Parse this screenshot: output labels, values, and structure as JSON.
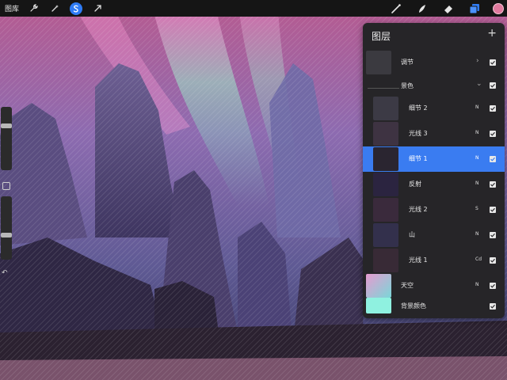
{
  "toolbar": {
    "gallery_label": "图库",
    "tools_left": [
      "wrench-icon",
      "magic-wand-icon",
      "selection-icon",
      "transform-icon"
    ],
    "tools_right": [
      "brush-icon",
      "smudge-icon",
      "eraser-icon",
      "layers-icon"
    ],
    "current_color": "#e07a9e",
    "active_tool_color": "#2f7cf6"
  },
  "layers_panel": {
    "title": "图层",
    "add_icon": "+",
    "rows": [
      {
        "label": "调节",
        "mode": "",
        "kind": "group",
        "expanded": false,
        "visible": true
      },
      {
        "label": "景色",
        "mode": "",
        "kind": "group",
        "expanded": true,
        "visible": true
      },
      {
        "label": "细节 2",
        "mode": "N",
        "kind": "layer",
        "visible": true
      },
      {
        "label": "光线 3",
        "mode": "N",
        "kind": "layer",
        "visible": true
      },
      {
        "label": "细节 1",
        "mode": "N",
        "kind": "layer",
        "visible": true,
        "selected": true
      },
      {
        "label": "反射",
        "mode": "N",
        "kind": "layer",
        "visible": true
      },
      {
        "label": "光线 2",
        "mode": "S",
        "kind": "layer",
        "visible": true
      },
      {
        "label": "山",
        "mode": "N",
        "kind": "layer",
        "visible": true
      },
      {
        "label": "光线 1",
        "mode": "Cd",
        "kind": "layer",
        "visible": true
      },
      {
        "label": "天空",
        "mode": "N",
        "kind": "layer",
        "visible": true
      },
      {
        "label": "背景颜色",
        "mode": "",
        "kind": "background",
        "visible": true,
        "color": "#8ff1e0"
      }
    ],
    "selected_color": "#3a7cf1"
  },
  "sidebar": {
    "brush_size": 0.72,
    "brush_opacity": 0.38,
    "undo_icon": "↶"
  }
}
